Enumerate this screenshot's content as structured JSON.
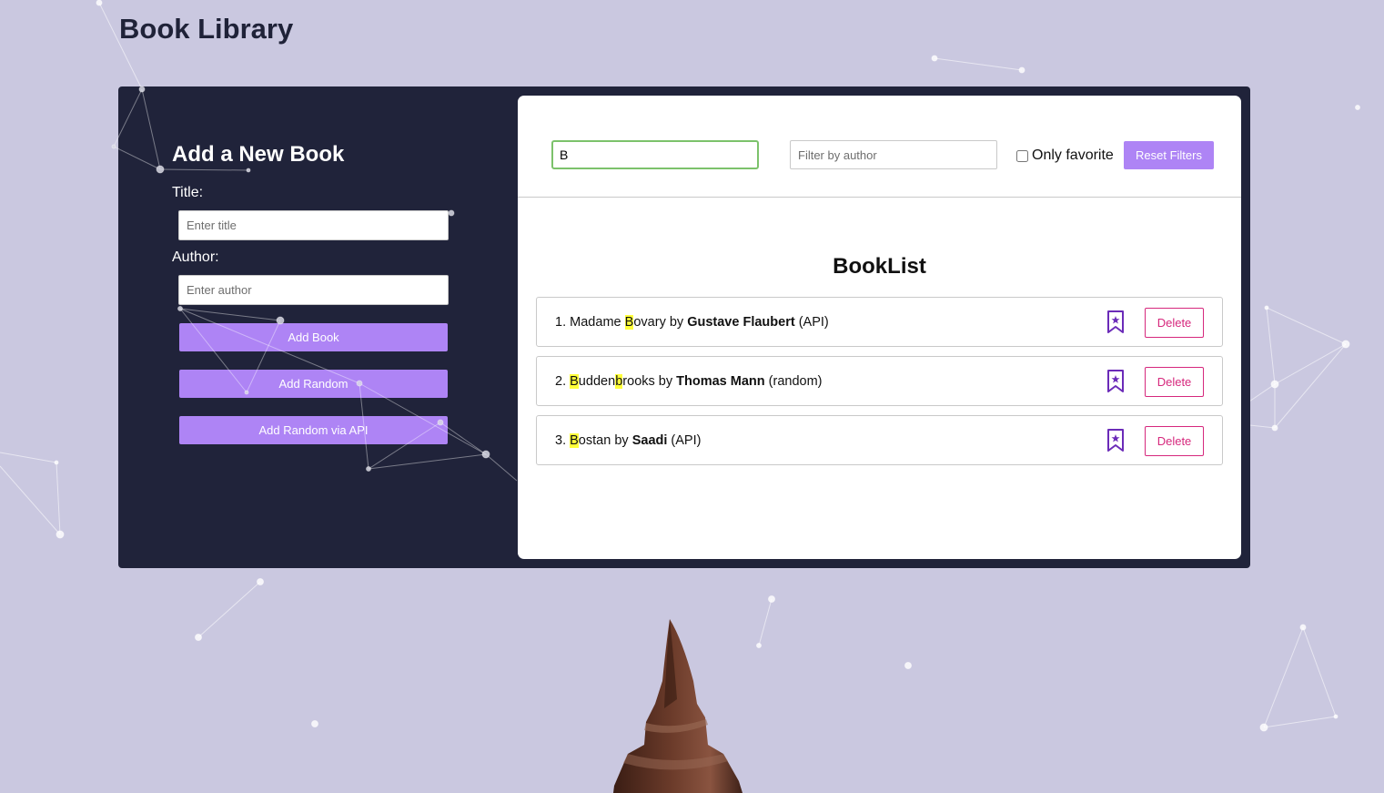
{
  "page": {
    "title": "Book Library"
  },
  "form": {
    "heading": "Add a New Book",
    "title_label": "Title:",
    "title_placeholder": "Enter title",
    "author_label": "Author:",
    "author_placeholder": "Enter author",
    "add_book_label": "Add Book",
    "add_random_label": "Add Random",
    "add_random_api_label": "Add Random via API"
  },
  "filters": {
    "search_value": "B",
    "author_placeholder": "Filter by author",
    "only_favorite_label": "Only favorite",
    "only_favorite_checked": false,
    "reset_label": "Reset Filters"
  },
  "book_list": {
    "heading": "BookList",
    "delete_label": "Delete",
    "books": [
      {
        "index": "1.",
        "title": "Madame Bovary",
        "by": "by",
        "author": "Gustave Flaubert",
        "source": "(API)"
      },
      {
        "index": "2.",
        "title": "Buddenbrooks",
        "by": "by",
        "author": "Thomas Mann",
        "source": "(random)"
      },
      {
        "index": "3.",
        "title": "Bostan",
        "by": "by",
        "author": "Saadi",
        "source": "(API)"
      }
    ]
  },
  "icons": {
    "bookmark": "bookmark-star-icon"
  },
  "colors": {
    "background": "#cac8e0",
    "panel": "#20233a",
    "accent_purple": "#ae84f5",
    "delete_pink": "#d6287d",
    "bookmark_purple": "#6b2bb8",
    "highlight": "#ffff3a",
    "search_focus": "#7cc26b"
  }
}
